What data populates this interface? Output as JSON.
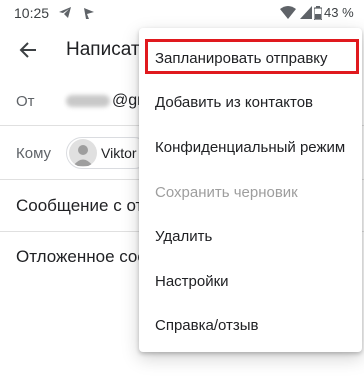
{
  "status_bar": {
    "time": "10:25",
    "battery_percent": "43 %",
    "icons": [
      "telegram-icon",
      "flag-notification-icon",
      "wifi-icon",
      "signal-icon",
      "battery-icon"
    ]
  },
  "app_bar": {
    "title": "Написат",
    "back_icon": "arrow-back-icon"
  },
  "compose": {
    "from_label": "От",
    "from_value_visible": "@gm",
    "to_label": "Кому",
    "to_chip": "Viktor",
    "subject": "Сообщение с от",
    "body": "Отложенное соо"
  },
  "menu": {
    "items": [
      {
        "label": "Запланировать отправку",
        "enabled": true,
        "highlighted": true
      },
      {
        "label": "Добавить из контактов",
        "enabled": true
      },
      {
        "label": "Конфиденциальный режим",
        "enabled": true
      },
      {
        "label": "Сохранить черновик",
        "enabled": false
      },
      {
        "label": "Удалить",
        "enabled": true
      },
      {
        "label": "Настройки",
        "enabled": true
      },
      {
        "label": "Справка/отзыв",
        "enabled": true
      }
    ]
  },
  "colors": {
    "highlight_border": "#e0191e",
    "disabled_text": "#9e9e9e",
    "text": "#202124",
    "secondary_text": "#5f6368"
  }
}
